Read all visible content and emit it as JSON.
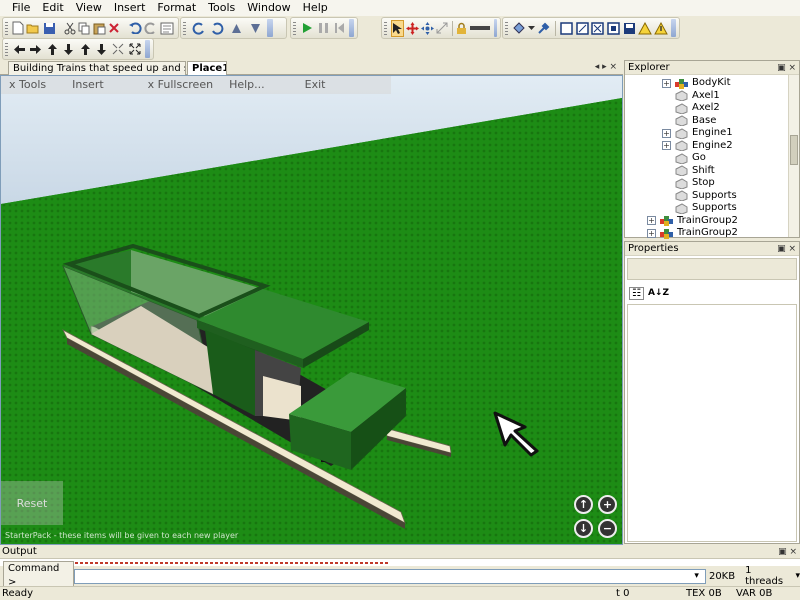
{
  "menu": [
    "File",
    "Edit",
    "View",
    "Insert",
    "Format",
    "Tools",
    "Window",
    "Help"
  ],
  "tabs": {
    "doc": "Building Trains that speed up and slow d...",
    "active": "Place1",
    "controls": "◂ ▸ ×"
  },
  "game_gui": {
    "items": [
      "x Tools",
      "Insert",
      "x Fullscreen",
      "Help...",
      "Exit"
    ],
    "reset": "Reset",
    "starterpack": "StarterPack - these items will be given to each new player"
  },
  "camera": {
    "up": "↑",
    "zoom_in": "+",
    "down": "↓",
    "zoom_out": "−"
  },
  "explorer": {
    "title": "Explorer",
    "items": [
      {
        "label": "BodyKit",
        "expandable": true,
        "icon": "model-icon",
        "indent": 1
      },
      {
        "label": "Axel1",
        "expandable": false,
        "icon": "part-icon",
        "indent": 1
      },
      {
        "label": "Axel2",
        "expandable": false,
        "icon": "part-icon",
        "indent": 1
      },
      {
        "label": "Base",
        "expandable": false,
        "icon": "part-icon",
        "indent": 1
      },
      {
        "label": "Engine1",
        "expandable": true,
        "icon": "part-icon",
        "indent": 1
      },
      {
        "label": "Engine2",
        "expandable": true,
        "icon": "part-icon",
        "indent": 1
      },
      {
        "label": "Go",
        "expandable": false,
        "icon": "part-icon",
        "indent": 1
      },
      {
        "label": "Shift",
        "expandable": false,
        "icon": "part-icon",
        "indent": 1
      },
      {
        "label": "Stop",
        "expandable": false,
        "icon": "part-icon",
        "indent": 1
      },
      {
        "label": "Supports",
        "expandable": false,
        "icon": "part-icon",
        "indent": 1
      },
      {
        "label": "Supports",
        "expandable": false,
        "icon": "part-icon",
        "indent": 1
      },
      {
        "label": "TrainGroup2",
        "expandable": true,
        "icon": "model-icon",
        "indent": 0
      },
      {
        "label": "TrainGroup2",
        "expandable": true,
        "icon": "model-icon",
        "indent": 0
      }
    ]
  },
  "properties": {
    "title": "Properties",
    "sort_category": "☷",
    "sort_alpha": "A↓Z"
  },
  "output": {
    "title": "Output"
  },
  "command": {
    "label": "Command >",
    "value": "",
    "memory": "20KB",
    "threads": "1 threads"
  },
  "status": {
    "ready": "Ready",
    "t": "t 0",
    "tex": "TEX 0B",
    "var": "VAR 0B"
  },
  "colors": {
    "grass": "#1a8a12",
    "train_green": "#2f8a2f",
    "rail": "#f3ecd2"
  }
}
